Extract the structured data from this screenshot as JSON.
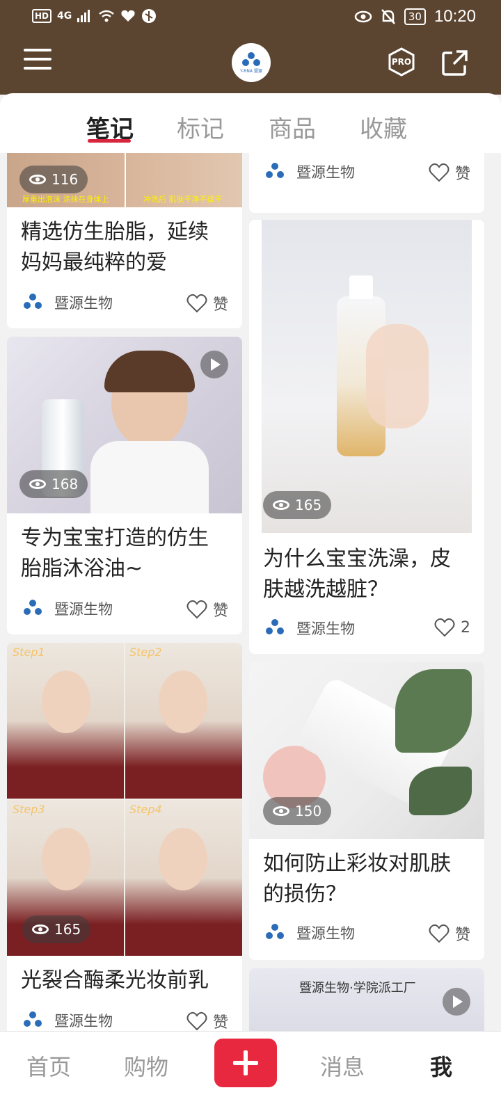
{
  "status_bar": {
    "network": "HD",
    "signal": "4G",
    "battery": "30",
    "time": "10:20"
  },
  "header": {
    "logo_text": "Y-RNA 暨源",
    "pro_label": "PRO"
  },
  "tabs": [
    {
      "label": "笔记",
      "active": true
    },
    {
      "label": "标记",
      "active": false
    },
    {
      "label": "商品",
      "active": false
    },
    {
      "label": "收藏",
      "active": false
    }
  ],
  "feed": {
    "left": [
      {
        "title_l1": "精选仿生胎脂，延续",
        "title_l2": "妈妈最纯粹的爱",
        "views": "116",
        "author": "暨源生物",
        "likes": "赞",
        "caption_a": "厚重出泡沫 涂抹在身体上",
        "caption_b": "冲洗后 肌肤干净不拔干"
      },
      {
        "title_l1": "专为宝宝打造的仿生",
        "title_l2": "胎脂沐浴油~",
        "views": "168",
        "author": "暨源生物",
        "likes": "赞"
      },
      {
        "title_l1": "光裂合酶柔光妆前乳",
        "title_l2": "",
        "views": "165",
        "author": "暨源生物",
        "likes": "赞",
        "steps": [
          "Step1",
          "Step2",
          "Step3",
          "Step4"
        ]
      }
    ],
    "right": [
      {
        "title_l1": "",
        "title_l2": "",
        "author": "暨源生物",
        "likes": "赞"
      },
      {
        "title_l1": "为什么宝宝洗澡，皮",
        "title_l2": "肤越洗越脏？",
        "views": "165",
        "author": "暨源生物",
        "likes": "2"
      },
      {
        "title_l1": "如何防止彩妆对肌肤",
        "title_l2": "的损伤？",
        "views": "150",
        "author": "暨源生物",
        "likes": "赞"
      },
      {
        "banner_text": "暨源生物·学院派工厂"
      }
    ]
  },
  "bottom_nav": [
    {
      "label": "首页",
      "active": false
    },
    {
      "label": "购物",
      "active": false
    },
    {
      "label": "消息",
      "active": false
    },
    {
      "label": "我",
      "active": true
    }
  ],
  "colors": {
    "header_bg": "#5b4530",
    "accent_red": "#e8283f",
    "brand_blue": "#2b6cb8"
  }
}
